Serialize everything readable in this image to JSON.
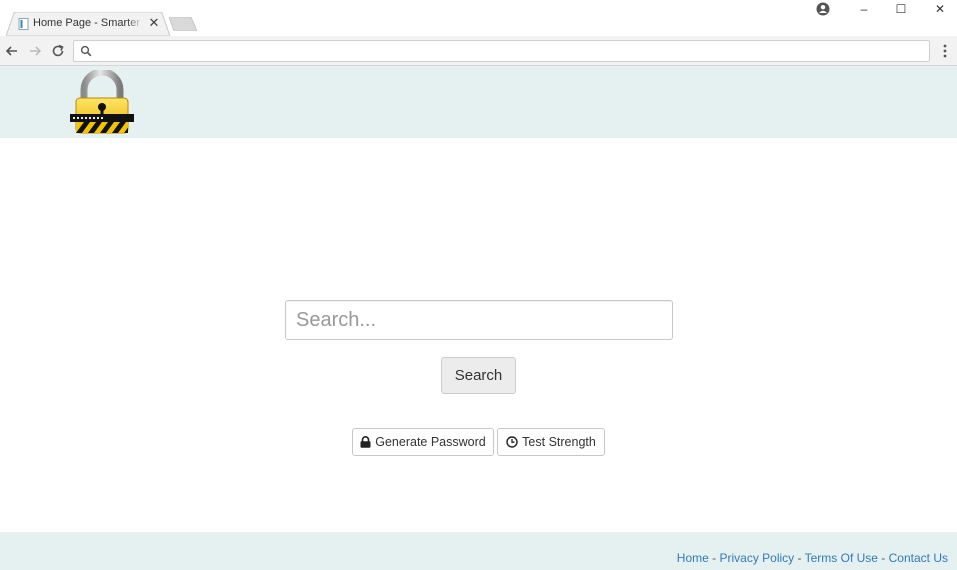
{
  "browser": {
    "tab_title": "Home Page - Smarter Passwords",
    "window_controls": {
      "minimize": "–",
      "maximize": "☐",
      "close": "✕"
    },
    "tab_close": "✕",
    "address_value": ""
  },
  "main": {
    "search_placeholder": "Search...",
    "search_button": "Search",
    "generate_button": "Generate Password",
    "test_button": "Test Strength"
  },
  "footer": {
    "links": [
      "Home",
      "Privacy Policy",
      "Terms Of Use",
      "Contact Us"
    ],
    "separator": " - "
  },
  "icons": {
    "logo": "padlock-logo-icon",
    "generate": "lock-icon",
    "test": "clock-icon"
  },
  "colors": {
    "header_bg": "#e5f0f0",
    "link": "#337ab7",
    "lock_gold": "#f5c400"
  }
}
